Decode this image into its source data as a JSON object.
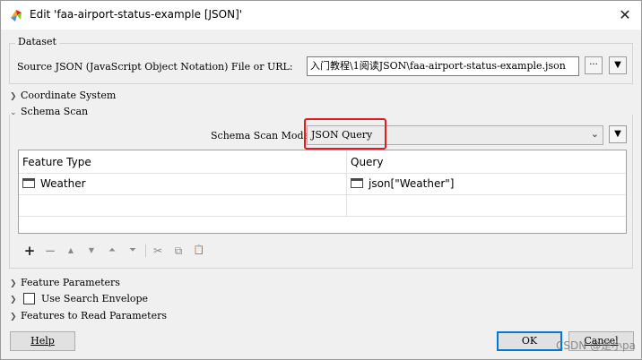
{
  "window": {
    "title": "Edit 'faa-airport-status-example [JSON]'",
    "close_glyph": "✕",
    "app_icon": "fme-workbench-icon"
  },
  "dataset": {
    "legend": "Dataset",
    "source_label": "Source JSON (JavaScript Object Notation) File or URL:",
    "source_value": "入门教程\\1阅读JSON\\faa-airport-status-example.json",
    "browse_label": "···",
    "menu_glyph": "▼"
  },
  "sections": {
    "coordinate_system": "Coordinate System",
    "schema_scan": "Schema Scan",
    "feature_parameters": "Feature Parameters",
    "use_search_envelope": "Use Search Envelope",
    "features_to_read": "Features to Read Parameters"
  },
  "schema_scan": {
    "mode_label": "Schema Scan Mode:",
    "mode_value": "JSON Query",
    "mode_chevron": "⌄",
    "menu_glyph": "▼",
    "highlight_color": "#e8191b",
    "table": {
      "headers": [
        "Feature Type",
        "Query"
      ],
      "rows": [
        {
          "feature_type": "Weather",
          "query": "json[\"Weather\"]"
        }
      ]
    },
    "toolbar": {
      "add": "+",
      "remove": "−",
      "move_up": "▲",
      "move_down": "▼",
      "move_top": "⏶",
      "move_bottom": "⏷",
      "cut": "✂",
      "copy": "⧉",
      "paste": "📋"
    }
  },
  "footer": {
    "help": "Help",
    "ok": "OK",
    "cancel": "Cancel",
    "accent_color": "#0078d7"
  },
  "watermark": "CSDN @是小pa"
}
